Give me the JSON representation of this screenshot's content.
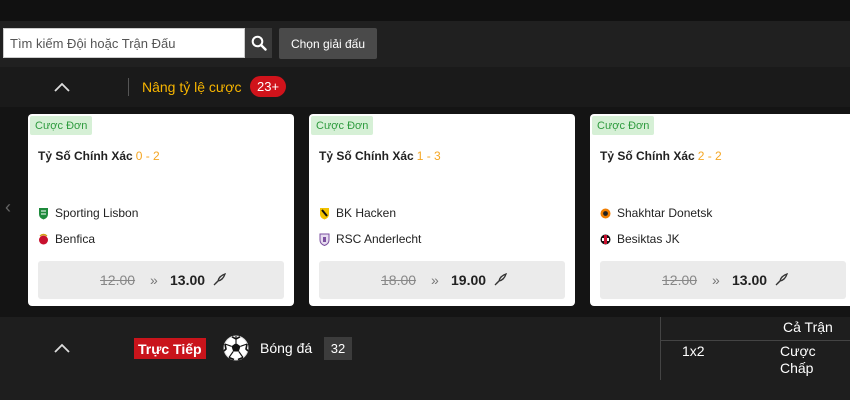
{
  "search": {
    "placeholder": "Tìm kiếm Đội hoặc Trận Đấu",
    "league_button": "Chọn giải đấu"
  },
  "boost": {
    "title": "Nâng tỷ lệ cược",
    "badge": "23+"
  },
  "cards": [
    {
      "tag": "Cược Đơn",
      "title": "Tỷ Số Chính Xác",
      "score": "0 - 2",
      "home": {
        "name": "Sporting Lisbon"
      },
      "away": {
        "name": "Benfica"
      },
      "old_odds": "12.00",
      "arrow": "»",
      "new_odds": "13.00"
    },
    {
      "tag": "Cược Đơn",
      "title": "Tỷ Số Chính Xác",
      "score": "1 - 3",
      "home": {
        "name": "BK Hacken"
      },
      "away": {
        "name": "RSC Anderlecht"
      },
      "old_odds": "18.00",
      "arrow": "»",
      "new_odds": "19.00"
    },
    {
      "tag": "Cược Đơn",
      "title": "Tỷ Số Chính Xác",
      "score": "2 - 2",
      "home": {
        "name": "Shakhtar Donetsk"
      },
      "away": {
        "name": "Besiktas JK"
      },
      "old_odds": "12.00",
      "arrow": "»",
      "new_odds": "13.00"
    }
  ],
  "live": {
    "badge": "Trực Tiếp",
    "sport": "Bóng đá",
    "count": "32"
  },
  "markets": {
    "full_match": "Cả Trận",
    "m1x2": "1x2",
    "handicap": "Cược Chấp"
  },
  "colors": {
    "accent": "#f7b500",
    "live_red": "#c9141b",
    "tag_green": "#2e9b3e",
    "score_orange": "#f5a623"
  }
}
